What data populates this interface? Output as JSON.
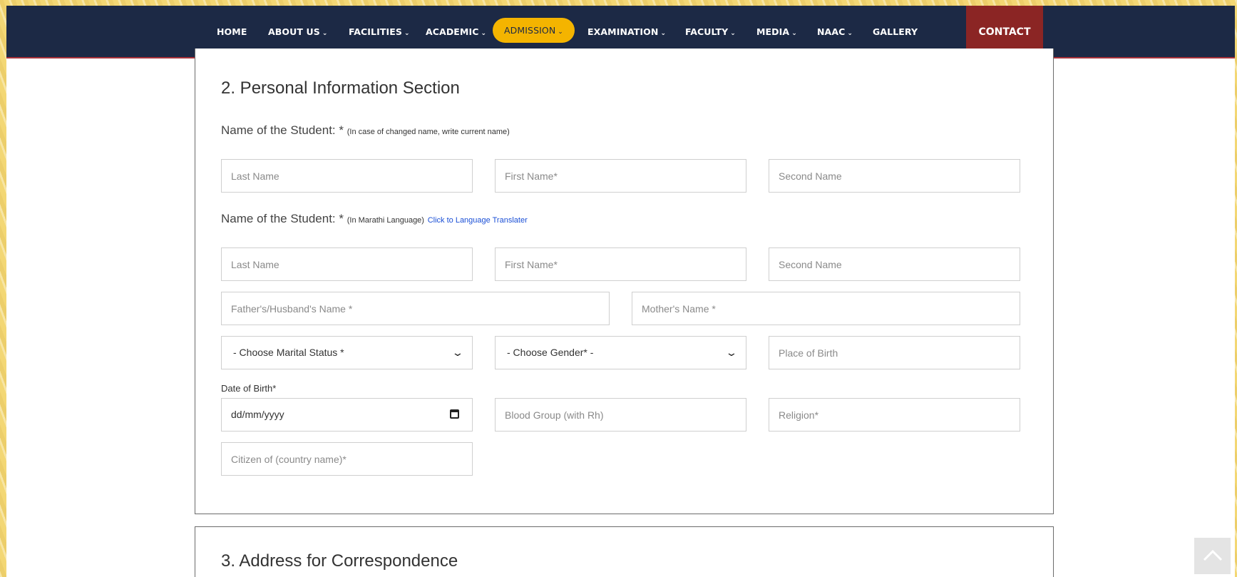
{
  "nav": {
    "items": [
      {
        "label": "HOME",
        "chevron": false
      },
      {
        "label": "ABOUT US",
        "chevron": true
      },
      {
        "label": "FACILITIES",
        "chevron": true
      },
      {
        "label": "ACADEMIC",
        "chevron": true
      },
      {
        "label": "ADMISSION",
        "chevron": true,
        "active": true
      },
      {
        "label": "EXAMINATION",
        "chevron": true
      },
      {
        "label": "FACULTY",
        "chevron": true
      },
      {
        "label": "MEDIA",
        "chevron": true
      },
      {
        "label": "NAAC",
        "chevron": true
      },
      {
        "label": "GALLERY",
        "chevron": false
      }
    ],
    "contact": "CONTACT",
    "active_color": "#f4b400",
    "bar_color": "#1c2945",
    "contact_color": "#8b2524"
  },
  "personal": {
    "title": "2. Personal Information Section",
    "name_label": "Name of the Student: *",
    "name_note": "(In case of changed name, write current name)",
    "marathi_label": "Name of the Student: *",
    "marathi_note": "(In Marathi Language)",
    "translator_link": "Click to Language Translater",
    "last_name": "Last Name",
    "first_name": "First Name*",
    "second_name": "Second Name",
    "marathi_last_name": "Last Name",
    "marathi_first_name": "First Name*",
    "marathi_second_name": "Second Name",
    "father_name": "Father's/Husband's Name *",
    "mother_name": "Mother's Name *",
    "marital_status": "- Choose Marital Status *",
    "gender": "- Choose Gender* -",
    "place_of_birth": "Place of Birth",
    "dob_label": "Date of Birth*",
    "dob_value": "dd/mm/yyyy",
    "blood_group": "Blood Group (with Rh)",
    "religion": "Religion*",
    "citizen": "Citizen of (country name)*"
  },
  "address": {
    "title": "3. Address for Correspondence"
  }
}
